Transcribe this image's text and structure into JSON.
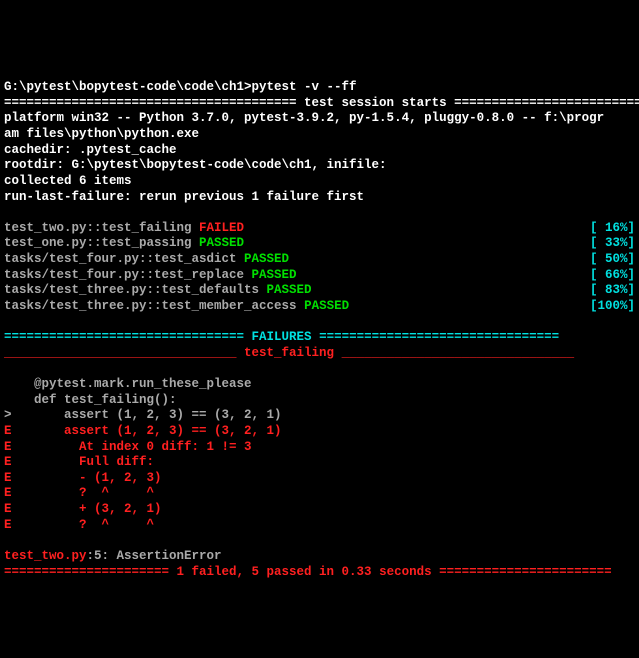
{
  "prompt_line": "G:\\pytest\\bopytest-code\\code\\ch1>pytest -v --ff",
  "session_start_rule": "======================================= test session starts =======================================",
  "platform_line1": "platform win32 -- Python 3.7.0, pytest-3.9.2, py-1.5.4, pluggy-0.8.0 -- f:\\progr",
  "platform_line2": "am files\\python\\python.exe",
  "cachedir": "cachedir: .pytest_cache",
  "rootdir": "rootdir: G:\\pytest\\bopytest-code\\code\\ch1, inifile:",
  "collected": "collected 6 items",
  "rlf": "run-last-failure: rerun previous 1 failure first",
  "tests": [
    {
      "id": "test_two.py::test_failing ",
      "status": "FAILED",
      "pct": "[ 16%]",
      "status_color": "red"
    },
    {
      "id": "test_one.py::test_passing ",
      "status": "PASSED",
      "pct": "[ 33%]",
      "status_color": "green"
    },
    {
      "id": "tasks/test_four.py::test_asdict ",
      "status": "PASSED",
      "pct": "[ 50%]",
      "status_color": "green"
    },
    {
      "id": "tasks/test_four.py::test_replace ",
      "status": "PASSED",
      "pct": "[ 66%]",
      "status_color": "green"
    },
    {
      "id": "tasks/test_three.py::test_defaults ",
      "status": "PASSED",
      "pct": "[ 83%]",
      "status_color": "green"
    },
    {
      "id": "tasks/test_three.py::test_member_access ",
      "status": "PASSED",
      "pct": "[100%]",
      "status_color": "green"
    }
  ],
  "failures_rule_left": "================================ ",
  "failures_label": "FAILURES",
  "failures_rule_right": " ================================",
  "tf_rule_left": "_______________________________ ",
  "tf_label": "test_failing",
  "tf_rule_right": " _______________________________",
  "src": {
    "l1": "    @pytest.mark.run_these_please",
    "l2": "    def test_failing():",
    "l3_marker": ">",
    "l3_code": "       assert (1, 2, 3) == (3, 2, 1)",
    "e1_m": "E",
    "e1": "       assert (1, 2, 3) == (3, 2, 1)",
    "e2_m": "E",
    "e2": "         At index 0 diff: 1 != 3",
    "e3_m": "E",
    "e3": "         Full diff:",
    "e4_m": "E",
    "e4": "         - (1, 2, 3)",
    "e5_m": "E",
    "e5": "         ?  ^     ^",
    "e6_m": "E",
    "e6": "         + (3, 2, 1)",
    "e7_m": "E",
    "e7": "         ?  ^     ^"
  },
  "loc_file": "test_two.py",
  "loc_rest": ":5: AssertionError",
  "summary_rule_left": "====================== ",
  "summary_label": "1 failed, 5 passed in 0.33 seconds",
  "summary_rule_right": " ======================="
}
